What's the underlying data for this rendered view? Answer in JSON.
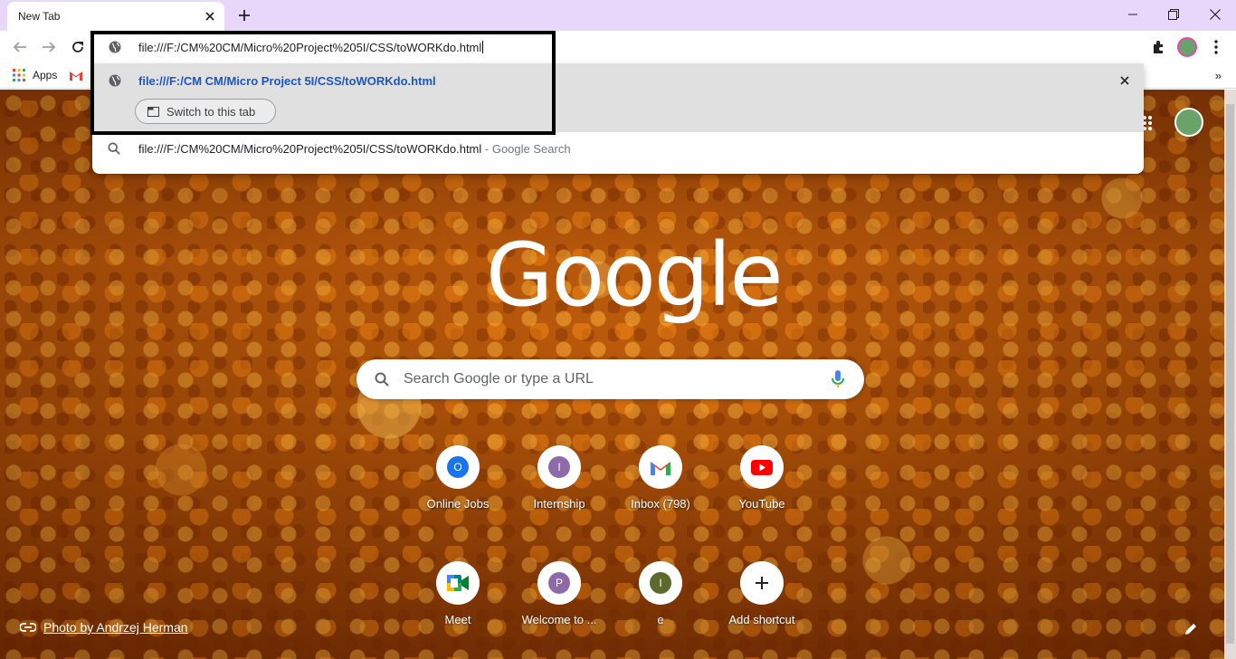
{
  "tab": {
    "title": "New Tab"
  },
  "omnibox": {
    "url": "file:///F:/CM%20CM/Micro%20Project%205I/CSS/toWORKdo.html"
  },
  "bookmarks": {
    "apps_label": "Apps"
  },
  "dropdown": {
    "suggestion_url": "file:///F:/CM CM/Micro Project 5I/CSS/toWORKdo.html",
    "switch_label": "Switch to this tab",
    "search_query": "file:///F:/CM%20CM/Micro%20Project%205I/CSS/toWORKdo.html",
    "search_suffix": " - Google Search"
  },
  "ntp": {
    "logo": "Google",
    "search_placeholder": "Search Google or type a URL",
    "photo_credit": "Photo by Andrzej Herman",
    "shortcuts": [
      {
        "label": "Online Jobs",
        "letter": "O",
        "color": "#1a73e8"
      },
      {
        "label": "Internship",
        "letter": "I",
        "color": "#8e6aa8"
      },
      {
        "label": "Inbox (798)",
        "icon": "gmail-icon"
      },
      {
        "label": "YouTube",
        "icon": "youtube-icon"
      },
      {
        "label": "Meet",
        "icon": "meet-icon"
      },
      {
        "label": "Welcome to ...",
        "letter": "P",
        "color": "#8e6aa8"
      },
      {
        "label": "e",
        "letter": "I",
        "color": "#5b6b2e"
      },
      {
        "label": "Add shortcut",
        "icon": "plus-icon"
      }
    ]
  },
  "colors": {
    "titlebar": "#e9d6fb",
    "link_blue": "#1a57c4",
    "highlight_border": "#000000"
  }
}
